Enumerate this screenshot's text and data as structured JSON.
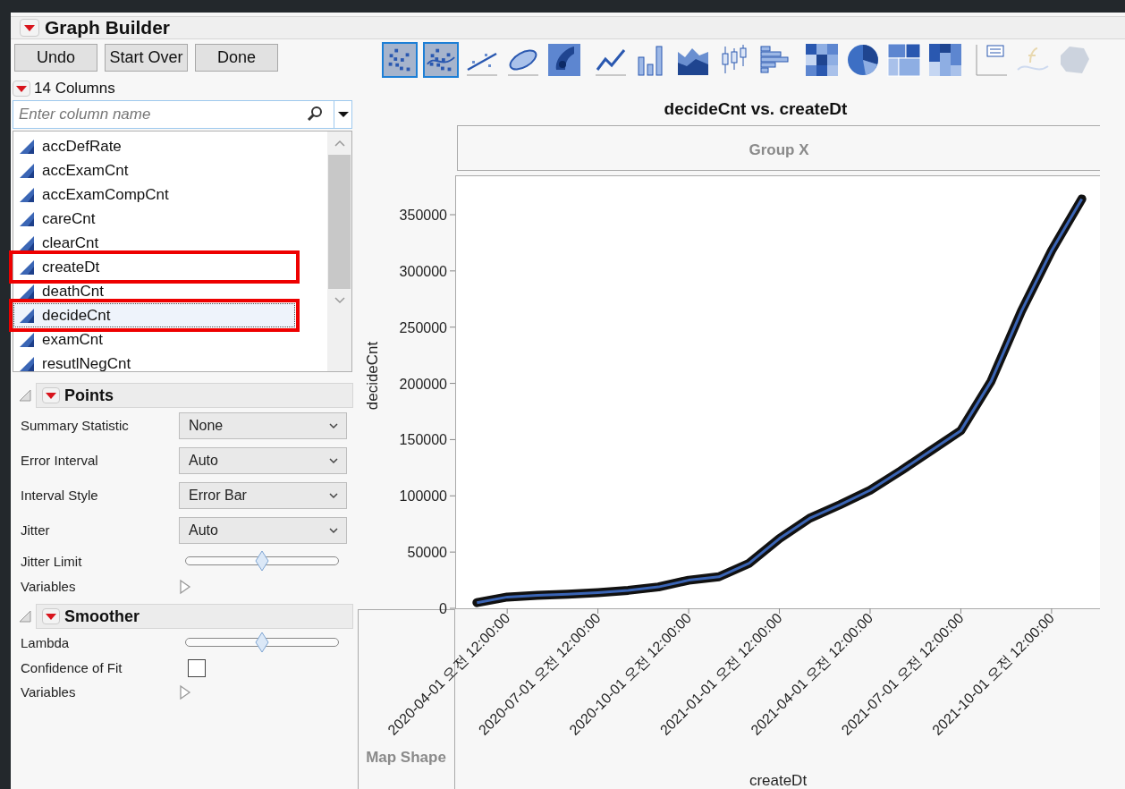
{
  "window": {
    "title": "Graph Builder"
  },
  "buttons": [
    "Undo",
    "Start Over",
    "Done"
  ],
  "columns_header": "14 Columns",
  "search": {
    "placeholder": "Enter column name"
  },
  "columns": [
    {
      "name": "accDefRate",
      "selected": false,
      "highlighted": false
    },
    {
      "name": "accExamCnt",
      "selected": false,
      "highlighted": false
    },
    {
      "name": "accExamCompCnt",
      "selected": false,
      "highlighted": false
    },
    {
      "name": "careCnt",
      "selected": false,
      "highlighted": false
    },
    {
      "name": "clearCnt",
      "selected": false,
      "highlighted": false
    },
    {
      "name": "createDt",
      "selected": false,
      "highlighted": true
    },
    {
      "name": "deathCnt",
      "selected": false,
      "highlighted": false
    },
    {
      "name": "decideCnt",
      "selected": true,
      "highlighted": true
    },
    {
      "name": "examCnt",
      "selected": false,
      "highlighted": false
    },
    {
      "name": "resutlNegCnt",
      "selected": false,
      "highlighted": false
    }
  ],
  "sections": [
    {
      "title": "Points",
      "expanded": true,
      "rows": [
        {
          "kind": "dropdown",
          "label": "Summary Statistic",
          "value": "None"
        },
        {
          "kind": "dropdown",
          "label": "Error Interval",
          "value": "Auto"
        },
        {
          "kind": "dropdown",
          "label": "Interval Style",
          "value": "Error Bar"
        },
        {
          "kind": "dropdown",
          "label": "Jitter",
          "value": "Auto"
        },
        {
          "kind": "slider",
          "label": "Jitter Limit",
          "level": 0.5
        },
        {
          "kind": "expander",
          "label": "Variables"
        }
      ]
    },
    {
      "title": "Smoother",
      "expanded": true,
      "rows": [
        {
          "kind": "slider",
          "label": "Lambda",
          "level": 0.5
        },
        {
          "kind": "checkbox",
          "label": "Confidence of Fit",
          "checked": false
        },
        {
          "kind": "expander",
          "label": "Variables"
        }
      ]
    }
  ],
  "toolbar": [
    [
      {
        "kind": "points",
        "selected": true,
        "disabled": false
      },
      {
        "kind": "smoother",
        "selected": true,
        "disabled": false
      },
      {
        "kind": "line-of-fit",
        "selected": false,
        "disabled": false
      },
      {
        "kind": "ellipse",
        "selected": false,
        "disabled": false
      },
      {
        "kind": "contour",
        "selected": false,
        "disabled": false
      }
    ],
    [
      {
        "kind": "line",
        "selected": false,
        "disabled": false
      },
      {
        "kind": "bar",
        "selected": false,
        "disabled": false
      },
      {
        "kind": "area",
        "selected": false,
        "disabled": false
      },
      {
        "kind": "box-plot",
        "selected": false,
        "disabled": false
      },
      {
        "kind": "histogram",
        "selected": false,
        "disabled": false
      }
    ],
    [
      {
        "kind": "heatmap",
        "selected": false,
        "disabled": false
      },
      {
        "kind": "pie",
        "selected": false,
        "disabled": false
      },
      {
        "kind": "treemap",
        "selected": false,
        "disabled": false
      },
      {
        "kind": "mosaic",
        "selected": false,
        "disabled": false
      }
    ],
    [
      {
        "kind": "caption-box",
        "selected": false,
        "disabled": false
      },
      {
        "kind": "formula",
        "selected": false,
        "disabled": true
      },
      {
        "kind": "map-shape",
        "selected": false,
        "disabled": true
      }
    ]
  ],
  "graph": {
    "group_x": "Group X",
    "map_shape": "Map Shape",
    "chart_data": {
      "type": "line",
      "title": "decideCnt vs. createDt",
      "xlabel": "createDt",
      "ylabel": "decideCnt",
      "categories": [
        null,
        "2020-04-01 오전 12:00:00",
        null,
        null,
        "2020-07-01 오전 12:00:00",
        null,
        null,
        "2020-10-01 오전 12:00:00",
        null,
        null,
        "2021-01-01 오전 12:00:00",
        null,
        null,
        "2021-04-01 오전 12:00:00",
        null,
        null,
        "2021-07-01 오전 12:00:00",
        null,
        null,
        "2021-10-01 오전 12:00:00",
        null
      ],
      "series": [
        {
          "color": "#3a64b4",
          "values": [
            5000,
            10000,
            11500,
            12500,
            14000,
            16000,
            19000,
            25000,
            28000,
            40000,
            62000,
            80000,
            92000,
            105000,
            122000,
            140000,
            158000,
            202000,
            264000,
            318000,
            364000
          ]
        }
      ],
      "ylim": [
        0,
        385000
      ],
      "yticks": [
        0,
        50000,
        100000,
        150000,
        200000,
        250000,
        300000,
        350000
      ]
    }
  }
}
